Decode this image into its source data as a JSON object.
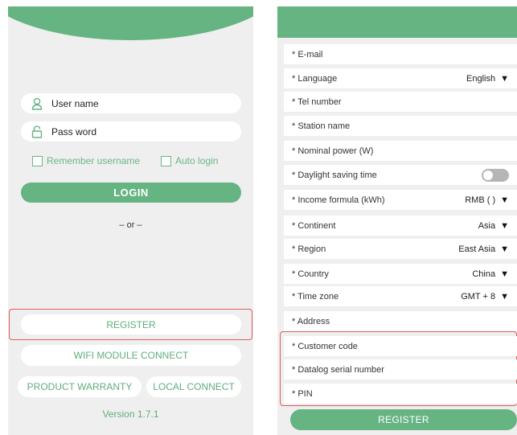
{
  "colors": {
    "accent": "#65b482",
    "text_green": "#5fae7c",
    "highlight_red": "#e05a5a",
    "panel_bg": "#efefef"
  },
  "login_screen": {
    "username_placeholder": "User name",
    "username_icon": "person-icon",
    "password_placeholder": "Pass word",
    "password_icon": "lock-icon",
    "remember_label": "Remember username",
    "auto_login_label": "Auto login",
    "login_button": "LOGIN",
    "or_divider": "– or –",
    "register_button": "REGISTER",
    "wifi_button": "WIFI MODULE CONNECT",
    "warranty_button": "PRODUCT WARRANTY",
    "local_connect_button": "LOCAL CONNECT",
    "version": "Version 1.7.1"
  },
  "register_screen": {
    "fields": [
      {
        "label": "* E-mail"
      },
      {
        "label": "* Language",
        "value": "English"
      },
      {
        "label": "* Tel number"
      },
      {
        "label": "* Station name"
      },
      {
        "label": "* Nominal power (W)"
      },
      {
        "label": "* Daylight saving time",
        "toggle": false
      },
      {
        "label": "* Income formula (kWh)",
        "value": "RMB (  )"
      },
      {
        "label": "* Continent",
        "value": "Asia"
      },
      {
        "label": "* Region",
        "value": "East Asia"
      },
      {
        "label": "* Country",
        "value": "China"
      },
      {
        "label": "* Time zone",
        "value": "GMT + 8"
      },
      {
        "label": "* Address"
      },
      {
        "label": "* Customer code"
      },
      {
        "label": "* Datalog serial number"
      },
      {
        "label": "* PIN"
      }
    ],
    "register_button": "REGISTER"
  }
}
